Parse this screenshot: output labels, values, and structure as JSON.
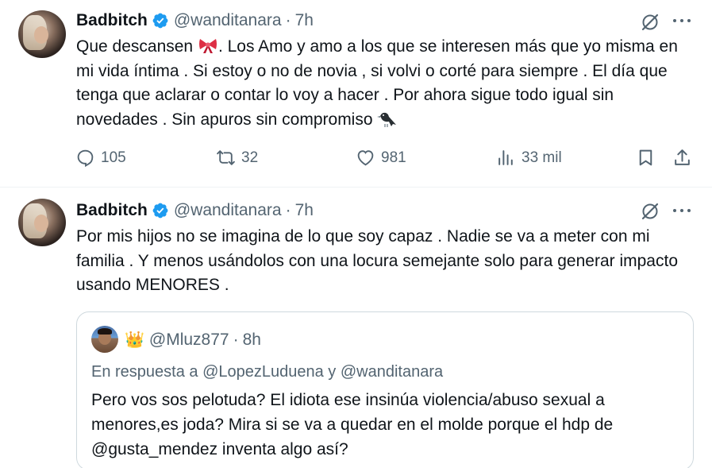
{
  "tweets": [
    {
      "name": "Badbitch",
      "handle": "@wanditanara",
      "separator": "·",
      "time": "7h",
      "text_part1": "Que descansen ",
      "text_part2": ". Los Amo y amo a los que se interesen más que yo misma en mi vida íntima . Si estoy o no de novia , si volvi o corté para siempre .  El día que tenga que aclarar o contar lo voy a hacer . Por ahora sigue todo igual sin novedades . Sin apuros sin compromiso ",
      "emoji1": "ribbon",
      "emoji2": "black-bird",
      "replies": "105",
      "retweets": "32",
      "likes": "981",
      "views": "33 mil"
    },
    {
      "name": "Badbitch",
      "handle": "@wanditanara",
      "separator": "·",
      "time": "7h",
      "text": "Por mis hijos no se imagina de lo que soy capaz .  Nadie se va a meter con mi familia . Y menos usándolos con una locura semejante solo para generar impacto usando MENORES .",
      "quote": {
        "crown": "👑",
        "handle": "@Mluz877",
        "separator": "·",
        "time": "8h",
        "reply_prefix": "En respuesta a ",
        "reply_user1": "@LopezLuduena",
        "reply_join": " y ",
        "reply_user2": "@wanditanara",
        "text": "Pero vos sos pelotuda? El idiota ese insinúa violencia/abuso sexual a menores,es joda? Mira si se va a quedar en el molde porque el hdp de @gusta_mendez inventa algo así?"
      }
    }
  ],
  "colors": {
    "text": "#0f1419",
    "secondary": "#536471",
    "verified": "#1d9bf0",
    "border": "#cfd9de"
  }
}
